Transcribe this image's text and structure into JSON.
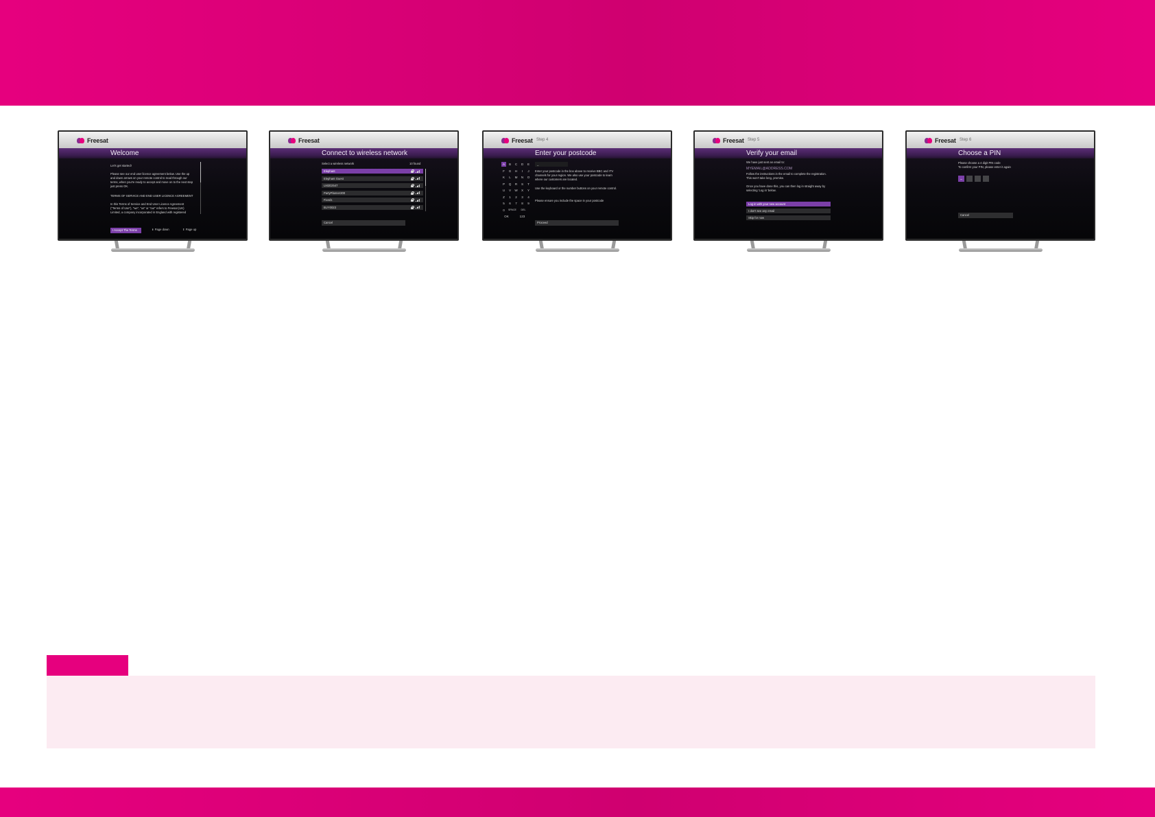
{
  "colors": {
    "brand_pink": "#e6007e",
    "freesat_purple": "#7b3fa8",
    "note_bg": "#fcebf2"
  },
  "brand": "Freesat",
  "screens": {
    "welcome": {
      "title": "Welcome",
      "intro": "Let's get started!",
      "body": "Please see our end user licence agreement below. Use the up and down arrows on your remote control to read through our terms, when you're ready to accept and move on to the next step just press OK.",
      "heading": "TERMS OF SERVICE AND END USER LICENCE AGREEMENT",
      "terms": "In this Terms of Service and End User Licence Agreement (\"Terms of Use\"), \"we\", \"us\" or \"our\" refers to Freesat (UK) Limited, a company incorporated in England with registered",
      "accept_button": "I Accept The Terms",
      "page_down": "Page down",
      "page_up": "Page up"
    },
    "wifi": {
      "title": "Connect to wireless network",
      "label": "Select a wireless network",
      "found": "10 found",
      "networks": [
        "Elephant",
        "Elephant Guest",
        "LM2D2547",
        "PartyPlanner200",
        "Fixed1",
        "BUY0023"
      ],
      "cancel": "Cancel"
    },
    "postcode": {
      "step": "Step 4",
      "title": "Enter your postcode",
      "keys": [
        "A",
        "B",
        "C",
        "D",
        "E",
        "F",
        "G",
        "H",
        "I",
        "J",
        "K",
        "L",
        "M",
        "N",
        "O",
        "P",
        "Q",
        "R",
        "S",
        "T",
        "U",
        "V",
        "W",
        "X",
        "Y",
        "Z",
        "1",
        "2",
        "3",
        "4",
        "5",
        "6",
        "7",
        "8",
        "9",
        "0",
        "SPACE",
        "DEL"
      ],
      "key_ok": "OK",
      "key_123": "123",
      "input_value": "_",
      "body1": "Enter your postcode in the box above to receive BBC and ITV channels for your region. We also use your postcode to learn where our customers are located.",
      "body2": "Use the keyboard or the number buttons on your remote control.",
      "body3": "Please ensure you include the space in your postcode",
      "proceed": "Proceed"
    },
    "verify": {
      "step": "Step 5",
      "title": "Verify your email",
      "line1": "We have just sent an email to:",
      "email": "MYEMAIL@ADDRESS.COM",
      "line2": "Follow the instructions in the email to complete the registration. This won't take long, promise.",
      "line3": "Once you have done this, you can then log in straight away by selecting 'Log in' below.",
      "options": [
        "Log in with your new account",
        "I don't see any email",
        "Skip for now"
      ]
    },
    "pin": {
      "step": "Step 6",
      "title": "Choose a PIN",
      "line1": "Please choose a 4 digit PIN code",
      "line2": "To confirm your PIN, please enter it again",
      "first_digit": "_",
      "cancel": "Cancel"
    }
  }
}
